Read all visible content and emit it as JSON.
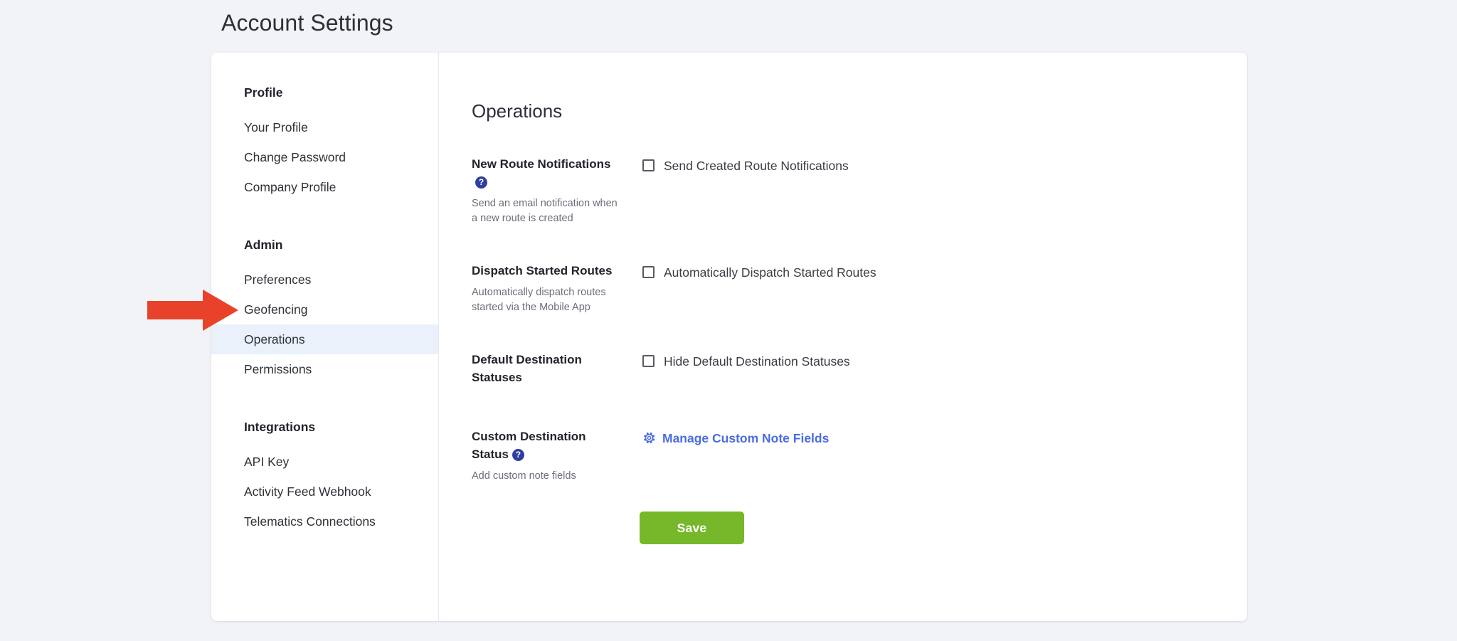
{
  "page": {
    "title": "Account Settings"
  },
  "sidebar": {
    "groups": [
      {
        "heading": "Profile",
        "items": [
          {
            "label": "Your Profile",
            "active": false
          },
          {
            "label": "Change Password",
            "active": false
          },
          {
            "label": "Company Profile",
            "active": false
          }
        ]
      },
      {
        "heading": "Admin",
        "items": [
          {
            "label": "Preferences",
            "active": false
          },
          {
            "label": "Geofencing",
            "active": false
          },
          {
            "label": "Operations",
            "active": true
          },
          {
            "label": "Permissions",
            "active": false
          }
        ]
      },
      {
        "heading": "Integrations",
        "items": [
          {
            "label": "API Key",
            "active": false
          },
          {
            "label": "Activity Feed Webhook",
            "active": false
          },
          {
            "label": "Telematics Connections",
            "active": false
          }
        ]
      }
    ]
  },
  "main": {
    "section_title": "Operations",
    "settings": [
      {
        "name": "New Route Notifications",
        "help": "?",
        "has_help": true,
        "description": "Send an email notification when a new route is created",
        "control": "checkbox",
        "checkbox_label": "Send Created Route Notifications",
        "checked": false
      },
      {
        "name": "Dispatch Started Routes",
        "help": "",
        "has_help": false,
        "description": "Automatically dispatch routes started via the Mobile App",
        "control": "checkbox",
        "checkbox_label": "Automatically Dispatch Started Routes",
        "checked": false
      },
      {
        "name": "Default Destination Statuses",
        "help": "",
        "has_help": false,
        "description": "",
        "control": "checkbox",
        "checkbox_label": "Hide Default Destination Statuses",
        "checked": false
      },
      {
        "name": "Custom Destination Status",
        "help": "?",
        "has_help": true,
        "description": "Add custom note fields",
        "control": "link",
        "link_label": "Manage Custom Note Fields",
        "link_icon": "gear-icon"
      }
    ],
    "save_label": "Save"
  },
  "annotation": {
    "type": "arrow",
    "direction": "right",
    "color": "#e8432a",
    "points_to": "Operations"
  },
  "colors": {
    "page_background": "#f2f3f7",
    "card_background": "#ffffff",
    "active_nav_background": "#eaf1fb",
    "link_blue": "#4a6ce0",
    "help_badge_blue": "#2f3fa0",
    "save_green": "#76b82a",
    "arrow_red": "#e8432a"
  }
}
